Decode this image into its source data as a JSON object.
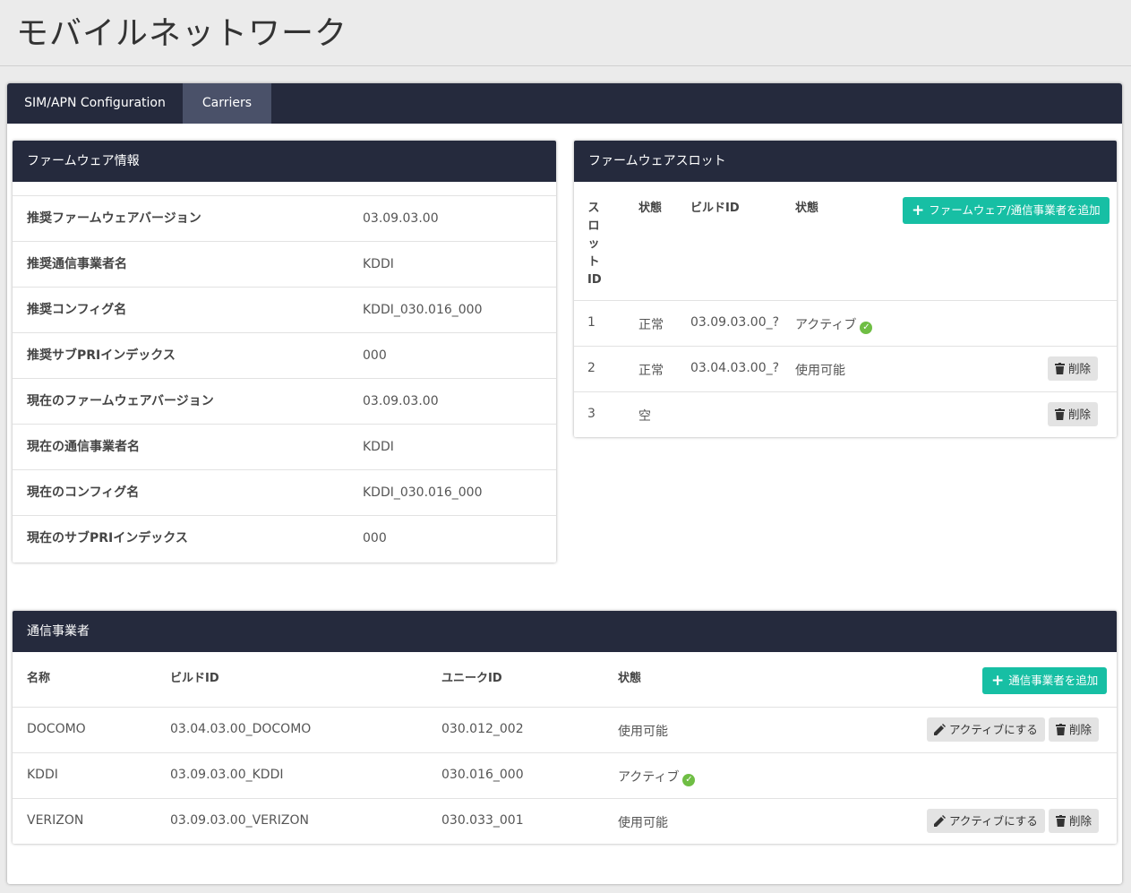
{
  "page": {
    "title": "モバイルネットワーク"
  },
  "tabs": [
    "SIM/APN Configuration",
    "Carriers"
  ],
  "firmware_info": {
    "title": "ファームウェア情報",
    "rows": [
      {
        "label": "推奨ファームウェアバージョン",
        "value": "03.09.03.00"
      },
      {
        "label": "推奨通信事業者名",
        "value": "KDDI"
      },
      {
        "label": "推奨コンフィグ名",
        "value": "KDDI_030.016_000"
      },
      {
        "label": "推奨サブPRIインデックス",
        "value": "000"
      },
      {
        "label": "現在のファームウェアバージョン",
        "value": "03.09.03.00"
      },
      {
        "label": "現在の通信事業者名",
        "value": "KDDI"
      },
      {
        "label": "現在のコンフィグ名",
        "value": "KDDI_030.016_000"
      },
      {
        "label": "現在のサブPRIインデックス",
        "value": "000"
      }
    ]
  },
  "firmware_slots": {
    "title": "ファームウェアスロット",
    "headers": {
      "slot_id": "スロットID",
      "state": "状態",
      "build_id": "ビルドID",
      "status": "状態"
    },
    "add_button": "ファームウェア/通信事業者を追加",
    "rows": [
      {
        "slot": "1",
        "state": "正常",
        "build": "03.09.03.00_?",
        "status": "アクティブ",
        "active": true
      },
      {
        "slot": "2",
        "state": "正常",
        "build": "03.04.03.00_?",
        "status": "使用可能",
        "delete": "削除"
      },
      {
        "slot": "3",
        "state": "空",
        "build": "",
        "status": "",
        "delete": "削除"
      }
    ]
  },
  "carriers": {
    "title": "通信事業者",
    "headers": {
      "name": "名称",
      "build_id": "ビルドID",
      "unique_id": "ユニークID",
      "status": "状態"
    },
    "add_button": "通信事業者を追加",
    "rows": [
      {
        "name": "DOCOMO",
        "build": "03.04.03.00_DOCOMO",
        "uid": "030.012_002",
        "status": "使用可能",
        "activate": "アクティブにする",
        "delete": "削除"
      },
      {
        "name": "KDDI",
        "build": "03.09.03.00_KDDI",
        "uid": "030.016_000",
        "status": "アクティブ",
        "active": true
      },
      {
        "name": "VERIZON",
        "build": "03.09.03.00_VERIZON",
        "uid": "030.033_001",
        "status": "使用可能",
        "activate": "アクティブにする",
        "delete": "削除"
      }
    ]
  }
}
